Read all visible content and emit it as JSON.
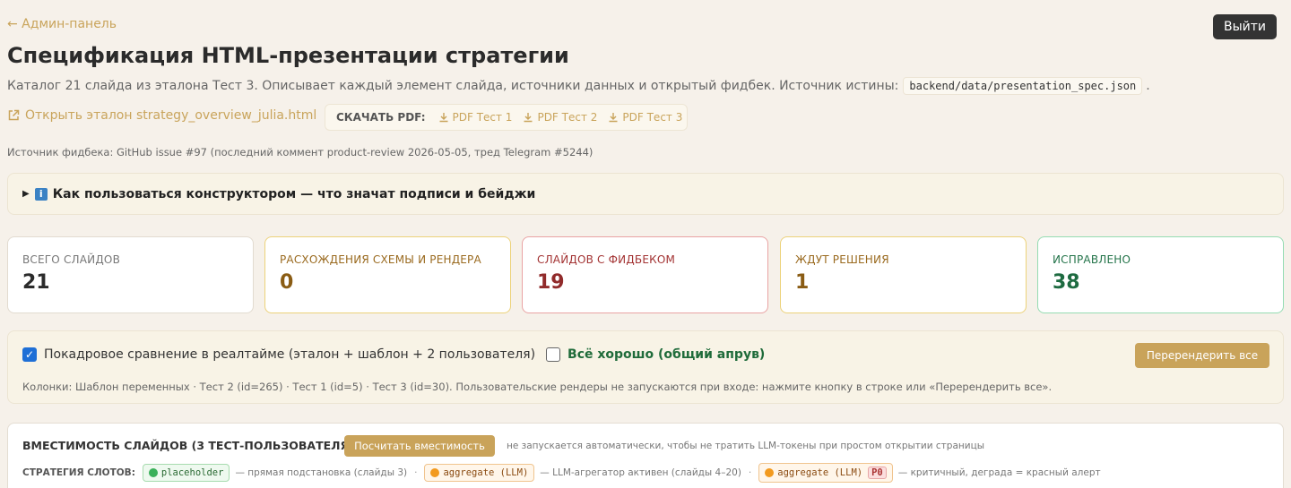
{
  "nav": {
    "back_label": "← Админ-панель",
    "logout_label": "Выйти"
  },
  "header": {
    "title": "Спецификация HTML-презентации стратегии",
    "subtitle_prefix": "Каталог 21 слайда из эталона Тест 3. Описывает каждый элемент слайда, источники данных и открытый фидбек. Источник истины:",
    "source_path": "backend/data/presentation_spec.json",
    "subtitle_suffix": "."
  },
  "links": {
    "open_reference_label": "Открыть эталон strategy_overview_julia.html",
    "pdf_label": "СКАЧАТЬ PDF:",
    "pdf_items": [
      "PDF Тест 1",
      "PDF Тест 2",
      "PDF Тест 3"
    ]
  },
  "feedback_source": "Источник фидбека: GitHub issue #97 (последний коммент product-review 2026-05-05, тред Telegram #5244)",
  "help": {
    "label": "Как пользоваться конструктором — что значат подписи и бейджи"
  },
  "stats": [
    {
      "label": "Всего слайдов",
      "value": "21"
    },
    {
      "label": "Расхождения схемы и рендера",
      "value": "0"
    },
    {
      "label": "Слайдов с фидбеком",
      "value": "19"
    },
    {
      "label": "Ждут решения",
      "value": "1"
    },
    {
      "label": "Исправлено",
      "value": "38"
    }
  ],
  "compare": {
    "realtime_label": "Покадровое сравнение в реалтайме (эталон + шаблон + 2 пользователя)",
    "realtime_checked": true,
    "approve_label": "Всё хорошо (общий апрув)",
    "approve_checked": false,
    "rerender_label": "Перерендерить все",
    "note": "Колонки: Шаблон переменных · Тест 2 (id=265) · Тест 1 (id=5) · Тест 3 (id=30). Пользовательские рендеры не запускаются при входе: нажмите кнопку в строке или «Перерендерить все»."
  },
  "capacity": {
    "title": "ВМЕСТИМОСТЬ СЛАЙДОВ (3 ТЕСТ-ПОЛЬЗОВАТЕЛЯ)",
    "button_label": "Посчитать вместимость",
    "note": "не запускается автоматически, чтобы не тратить LLM-токены при простом открытии страницы",
    "strategy_label": "СТРАТЕГИЯ СЛОТОВ:",
    "strategies": [
      {
        "name": "placeholder",
        "desc": "— прямая подстановка (слайды 3)"
      },
      {
        "name": "aggregate (LLM)",
        "desc": "— LLM-агрегатор активен (слайды 4–20)"
      },
      {
        "name": "aggregate (LLM)",
        "badge": "P0",
        "desc": "— критичный, деграда = красный алерт"
      }
    ],
    "separator": "·"
  },
  "colors": {
    "accent": "#c9a45b",
    "background": "#f6f1ea",
    "danger": "#912b2b",
    "success": "#1e6b41"
  }
}
